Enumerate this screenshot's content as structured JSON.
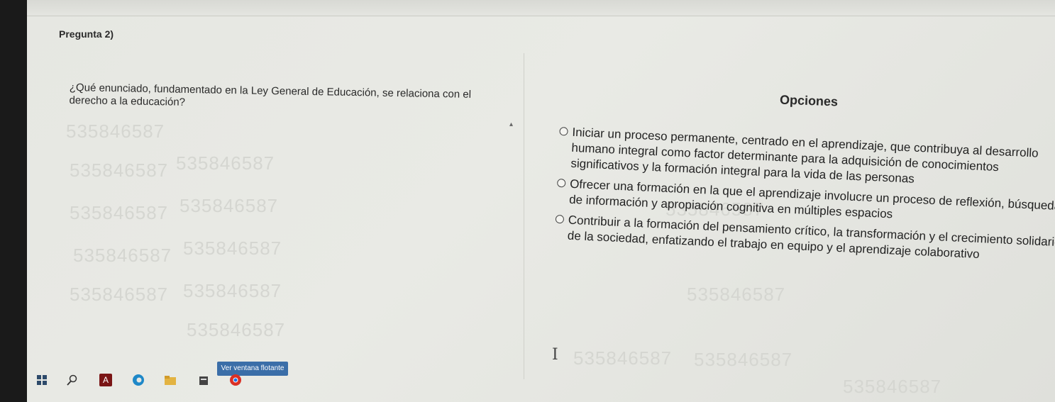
{
  "question": {
    "label": "Pregunta 2)",
    "text": "¿Qué enunciado, fundamentado en la Ley General de Educación, se relaciona con el derecho a la educación?"
  },
  "options": {
    "title": "Opciones",
    "items": [
      {
        "label": "Iniciar un proceso permanente, centrado en el aprendizaje, que contribuya al desarrollo humano integral como factor determinante para la adquisición de conocimientos significativos y la formación integral para la vida de las personas"
      },
      {
        "label": "Ofrecer una formación en la que el aprendizaje involucre un proceso de reflexión, búsqueda de información y apropiación cognitiva en múltiples espacios"
      },
      {
        "label": "Contribuir a la formación del pensamiento crítico, la transformación y el crecimiento solidario de la sociedad, enfatizando el trabajo en equipo y el aprendizaje colaborativo"
      }
    ]
  },
  "watermark": {
    "text": "535846587"
  },
  "taskbar": {
    "browser_button_label": "Ver ventana flotante",
    "icons": [
      "start-icon",
      "search-icon",
      "pdf-icon",
      "edge-icon",
      "file-explorer-icon",
      "app-icon",
      "chrome-icon"
    ]
  },
  "colors": {
    "background": "#e6e7e2",
    "text": "#222222",
    "button_blue": "#3b6ea8"
  }
}
